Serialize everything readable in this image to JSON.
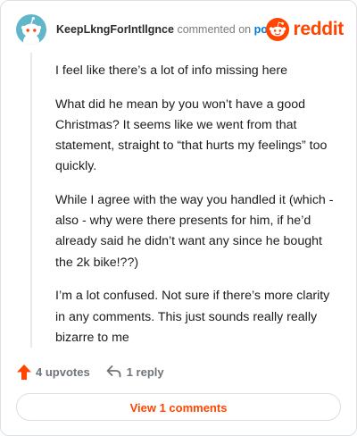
{
  "comment": {
    "username": "KeepLkngForIntllgnce",
    "action_text": "commented on",
    "post_link": "post",
    "brand": "reddit",
    "paragraphs": [
      "I feel like there’s a lot of info missing here",
      "What did he mean by you won’t have a good Christmas? It seems like we went from that statement, straight to “that hurts my feelings” too quickly.",
      "While I agree with the way you handled it (which - also - why were there presents for him, if he’d already said he didn’t want any since he bought the 2k bike!??)",
      "I’m a lot confused. Not sure if there’s more clarity in any comments. This just sounds really really bizarre to me"
    ],
    "upvotes_label": "4 upvotes",
    "replies_label": "1 reply",
    "view_comments_label": "View 1 comments"
  },
  "icons": {
    "avatar": "snoo-avatar-icon",
    "brand": "reddit-logo-icon",
    "upvote": "upvote-arrow-icon",
    "reply": "reply-arrow-icon"
  },
  "colors": {
    "accent": "#ff4500",
    "link": "#0079d3",
    "avatar_bg": "#5fb7c9"
  }
}
